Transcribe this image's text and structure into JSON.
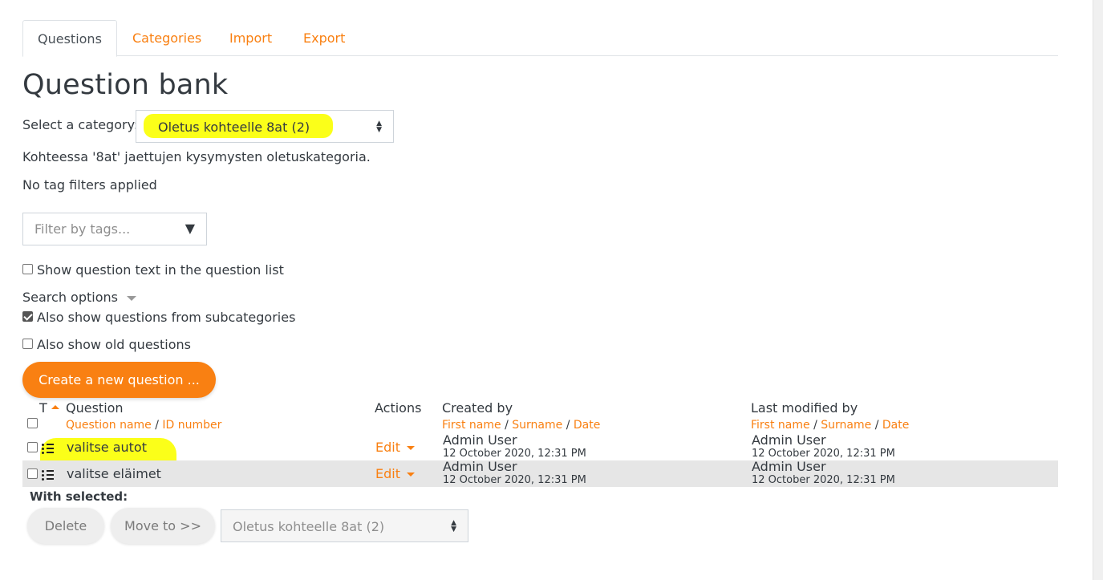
{
  "tabs": [
    {
      "label": "Questions",
      "active": true
    },
    {
      "label": "Categories"
    },
    {
      "label": "Import"
    },
    {
      "label": "Export"
    }
  ],
  "page_title": "Question bank",
  "category": {
    "label": "Select a category:",
    "selected": "Oletus kohteelle 8at (2)",
    "description": "Kohteessa '8at' jaettujen kysymysten oletuskategoria."
  },
  "tags": {
    "status": "No tag filters applied",
    "placeholder": "Filter by tags..."
  },
  "show_question_text": {
    "label": "Show question text in the question list",
    "checked": false
  },
  "search_options": {
    "label": "Search options",
    "subcategories": {
      "label": "Also show questions from subcategories",
      "checked": true
    },
    "old_questions": {
      "label": "Also show old questions",
      "checked": false
    }
  },
  "create_button": "Create a new question ...",
  "table": {
    "headers": {
      "type": "T",
      "question": "Question",
      "question_name": "Question name",
      "slash": "/",
      "id_number": "ID number",
      "actions": "Actions",
      "created_by": "Created by",
      "modified_by": "Last modified by",
      "first_name": "First name",
      "surname": "Surname",
      "date": "Date"
    },
    "rows": [
      {
        "name": "valitse autot",
        "action": "Edit",
        "created_user": "Admin User",
        "created_date": "12 October 2020, 12:31 PM",
        "modified_user": "Admin User",
        "modified_date": "12 October 2020, 12:31 PM"
      },
      {
        "name": "valitse eläimet",
        "action": "Edit",
        "created_user": "Admin User",
        "created_date": "12 October 2020, 12:31 PM",
        "modified_user": "Admin User",
        "modified_date": "12 October 2020, 12:31 PM"
      }
    ]
  },
  "bulk": {
    "label": "With selected:",
    "delete": "Delete",
    "move": "Move to >>",
    "target": "Oletus kohteelle 8at (2)"
  },
  "colors": {
    "accent": "#f98012",
    "highlight": "#fbff00"
  }
}
